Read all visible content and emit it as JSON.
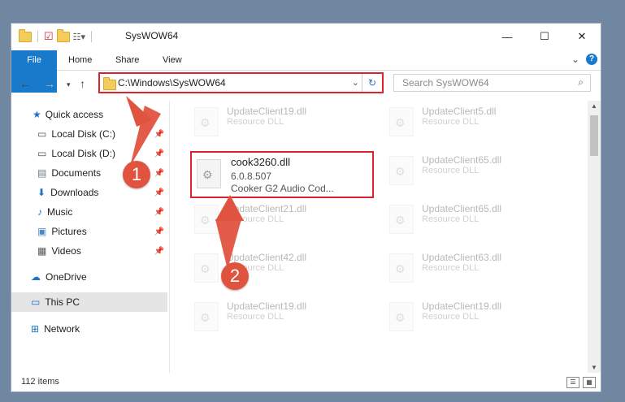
{
  "window": {
    "title": "SysWOW64",
    "controls": {
      "minimize": "—",
      "maximize": "☐",
      "close": "✕"
    }
  },
  "ribbon": {
    "tabs": [
      "File",
      "Home",
      "Share",
      "View"
    ],
    "help_icon": "?",
    "expand_icon": "⌄"
  },
  "nav": {
    "address": "C:\\Windows\\SysWOW64",
    "search_placeholder": "Search SysWOW64"
  },
  "sidebar": {
    "items": [
      {
        "label": "Quick access",
        "icon": "star-icon",
        "color": "#1a73c8"
      },
      {
        "label": "Local Disk (C:)",
        "icon": "drive-icon",
        "pinned": true
      },
      {
        "label": "Local Disk (D:)",
        "icon": "drive-icon",
        "pinned": true
      },
      {
        "label": "Documents",
        "icon": "document-icon",
        "pinned": true
      },
      {
        "label": "Downloads",
        "icon": "download-icon",
        "pinned": true
      },
      {
        "label": "Music",
        "icon": "music-icon",
        "pinned": true
      },
      {
        "label": "Pictures",
        "icon": "pictures-icon",
        "pinned": true
      },
      {
        "label": "Videos",
        "icon": "video-icon",
        "pinned": true
      },
      {
        "label": "OneDrive",
        "icon": "cloud-icon"
      },
      {
        "label": "This PC",
        "icon": "computer-icon",
        "selected": true
      },
      {
        "label": "Network",
        "icon": "network-icon"
      }
    ]
  },
  "files": {
    "left": [
      {
        "name": "UpdateClient19.dll",
        "desc": "Resource DLL"
      },
      {
        "name": "UpdateClient21.dll",
        "desc": "Resource DLL"
      },
      {
        "name": "UpdateClient42.dll",
        "desc": "Resource DLL"
      },
      {
        "name": "UpdateClient19.dll",
        "desc": "Resource DLL"
      }
    ],
    "right": [
      {
        "name": "UpdateClient5.dll",
        "desc": "Resource DLL"
      },
      {
        "name": "UpdateClient65.dll",
        "desc": "Resource DLL"
      },
      {
        "name": "UpdateClient65.dll",
        "desc": "Resource DLL"
      },
      {
        "name": "UpdateClient63.dll",
        "desc": "Resource DLL"
      },
      {
        "name": "UpdateClient19.dll",
        "desc": "Resource DLL"
      }
    ],
    "highlighted": {
      "name": "cook3260.dll",
      "version": "6.0.8.507",
      "desc": "Cooker G2 Audio Cod..."
    }
  },
  "status": {
    "count": "112 items"
  },
  "annotations": {
    "badge1": "1",
    "badge2": "2",
    "color": "#e0533f"
  }
}
